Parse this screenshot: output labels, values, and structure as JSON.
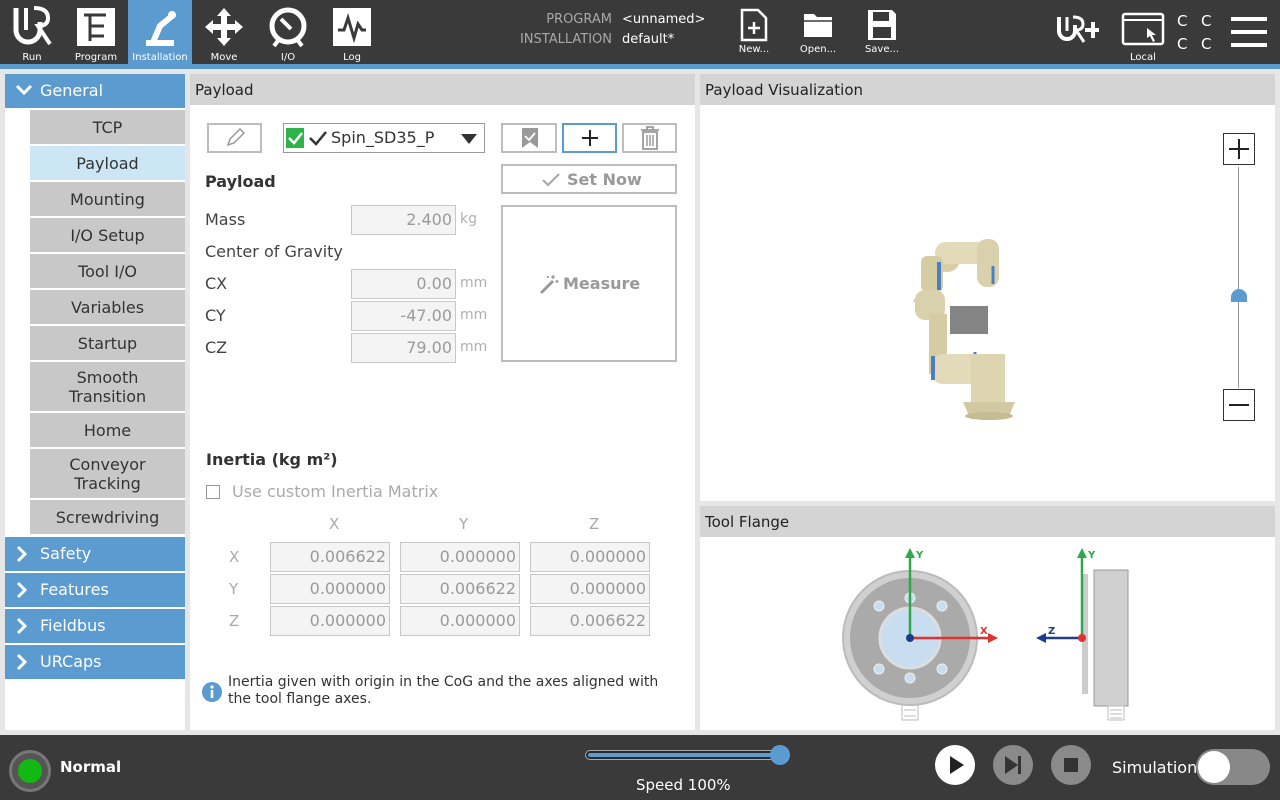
{
  "topbar": {
    "nav": [
      {
        "id": "run",
        "label": "Run"
      },
      {
        "id": "program",
        "label": "Program"
      },
      {
        "id": "installation",
        "label": "Installation"
      },
      {
        "id": "move",
        "label": "Move"
      },
      {
        "id": "io",
        "label": "I/O"
      },
      {
        "id": "log",
        "label": "Log"
      }
    ],
    "program_label": "PROGRAM",
    "program_value": "<unnamed>",
    "installation_label": "INSTALLATION",
    "installation_value": "default*",
    "file": {
      "new": "New...",
      "open": "Open...",
      "save": "Save..."
    },
    "local_label": "Local",
    "cc": [
      "C",
      "C",
      "C",
      "C"
    ]
  },
  "sidebar": {
    "general": "General",
    "general_items": [
      "TCP",
      "Payload",
      "Mounting",
      "I/O Setup",
      "Tool I/O",
      "Variables",
      "Startup",
      "Smooth Transition",
      "Home",
      "Conveyor Tracking",
      "Screwdriving"
    ],
    "other_categories": [
      "Safety",
      "Features",
      "Fieldbus",
      "URCaps"
    ]
  },
  "payload": {
    "header": "Payload",
    "selected": "Spin_SD35_P",
    "set_now": "Set Now",
    "section_title": "Payload",
    "mass_label": "Mass",
    "mass_value": "2.400",
    "mass_unit": "kg",
    "cog_label": "Center of Gravity",
    "cx_label": "CX",
    "cx_value": "0.00",
    "cy_label": "CY",
    "cy_value": "-47.00",
    "cz_label": "CZ",
    "cz_value": "79.00",
    "mm": "mm",
    "measure": "Measure",
    "inertia_title": "Inertia (kg m²)",
    "custom_inertia": "Use custom Inertia Matrix",
    "cols": [
      "X",
      "Y",
      "Z"
    ],
    "rows": [
      "X",
      "Y",
      "Z"
    ],
    "matrix": [
      [
        "0.006622",
        "0.000000",
        "0.000000"
      ],
      [
        "0.000000",
        "0.006622",
        "0.000000"
      ],
      [
        "0.000000",
        "0.000000",
        "0.006622"
      ]
    ],
    "info": "Inertia given with origin in the CoG and the axes aligned with the tool flange axes."
  },
  "visualization": {
    "header": "Payload Visualization",
    "zoom_level": 0.42
  },
  "tool_flange": {
    "header": "Tool Flange",
    "y": "Y",
    "x": "X",
    "z": "Z"
  },
  "bottombar": {
    "status": "Normal",
    "speed": "Speed 100%",
    "speed_fraction": 1.0,
    "simulation": "Simulation"
  }
}
